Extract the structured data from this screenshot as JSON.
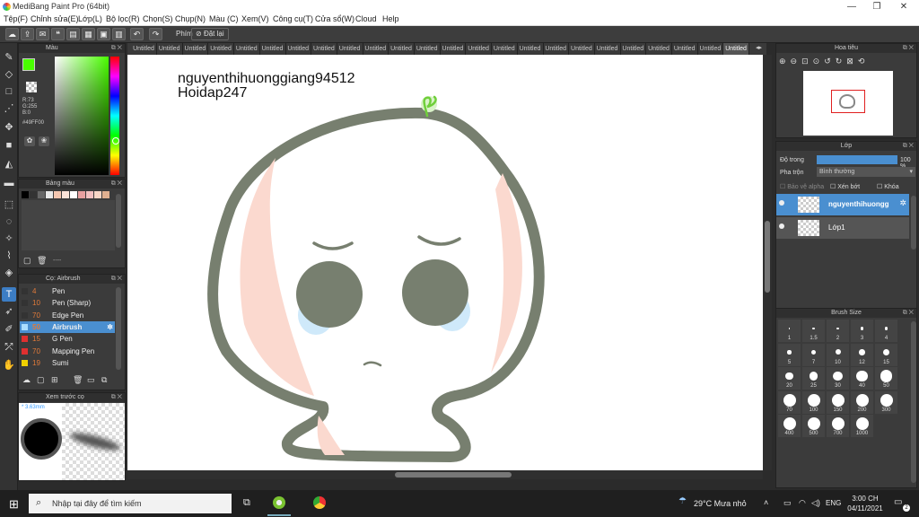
{
  "window": {
    "title": "MediBang Paint Pro (64bit)",
    "minimize": "—",
    "restore": "❐",
    "close": "✕"
  },
  "menu": [
    "Tệp(F)",
    "Chỉnh sửa(E)",
    "Lớp(L)",
    "Bộ lọc(R)",
    "Chọn(S)",
    "Chụp(N)",
    "Màu (C)",
    "Xem(V)",
    "Công cụ(T)",
    "Cửa sổ(W)",
    "Cloud",
    "Help"
  ],
  "toolbar": {
    "undo": "↶",
    "redo": "↷",
    "label_phim": "Phím",
    "reset": "Đặt lại"
  },
  "tabs": [
    "Untitled",
    "Untitled",
    "Untitled",
    "Untitled",
    "Untitled",
    "Untitled",
    "Untitled",
    "Untitled",
    "Untitled",
    "Untitled",
    "Untitled",
    "Untitled",
    "Untitled",
    "Untitled",
    "Untitled",
    "Untitled",
    "Untitled",
    "Untitled",
    "Untitled",
    "Untitled",
    "Untitled",
    "Untitled",
    "Untitled",
    "Untitled"
  ],
  "color_panel": {
    "title": "Màu",
    "r": "R:73",
    "g": "G:255",
    "b": "B:0",
    "hex": "#49FF00",
    "fg": "#49FF00"
  },
  "palette_panel": {
    "title": "Bảng màu",
    "swatches": [
      "#000000",
      "#333333",
      "#666666",
      "#e8e8e8",
      "#f4c6b0",
      "#fbe3d8",
      "#ffffff",
      "#e8a0a0",
      "#f2c0c0",
      "#f7d6c6",
      "#e0b090"
    ],
    "footer": "----"
  },
  "brush_panel": {
    "title": "Cọ: Airbrush",
    "items": [
      {
        "size": "4",
        "name": "Pen",
        "color": "#333333"
      },
      {
        "size": "10",
        "name": "Pen (Sharp)",
        "color": "#333333"
      },
      {
        "size": "70",
        "name": "Edge Pen",
        "color": "#333333"
      },
      {
        "size": "50",
        "name": "Airbrush",
        "color": "#aaddff",
        "selected": true
      },
      {
        "size": "15",
        "name": "G Pen",
        "color": "#e03030"
      },
      {
        "size": "70",
        "name": "Mapping Pen",
        "color": "#e03030"
      },
      {
        "size": "19",
        "name": "Sumi",
        "color": "#f0d000"
      }
    ]
  },
  "preview_panel": {
    "title": "Xem trước cọ",
    "size": "3.63mm"
  },
  "canvas": {
    "text_line1": "nguyenthihuonggiang94512",
    "text_line2": "Hoidap247"
  },
  "navigator": {
    "title": "Hoa tiêu"
  },
  "layer_panel": {
    "title": "Lớp",
    "opacity_label": "Độ trong",
    "opacity_value": "100 %",
    "opacity_fraction": 1.0,
    "blend_label": "Pha trộn",
    "blend_value": "Bình thường",
    "protect_alpha": "Bảo vệ alpha",
    "clip": "Xén bớt",
    "lock": "Khóa",
    "layers": [
      {
        "name": "nguyenthihuongg",
        "selected": true
      },
      {
        "name": "Lớp1",
        "selected": false
      }
    ]
  },
  "brush_size_panel": {
    "title": "Brush Size",
    "sizes": [
      "1",
      "1.5",
      "2",
      "3",
      "4",
      "5",
      "7",
      "10",
      "12",
      "15",
      "20",
      "25",
      "30",
      "40",
      "50",
      "70",
      "100",
      "150",
      "200",
      "300",
      "400",
      "500",
      "700",
      "1000"
    ]
  },
  "taskbar": {
    "search_placeholder": "Nhập tại đây để tìm kiếm",
    "weather": "29°C  Mưa nhỏ",
    "lang": "ENG",
    "time": "3:00 CH",
    "date": "04/11/2021",
    "notifications": "2"
  }
}
